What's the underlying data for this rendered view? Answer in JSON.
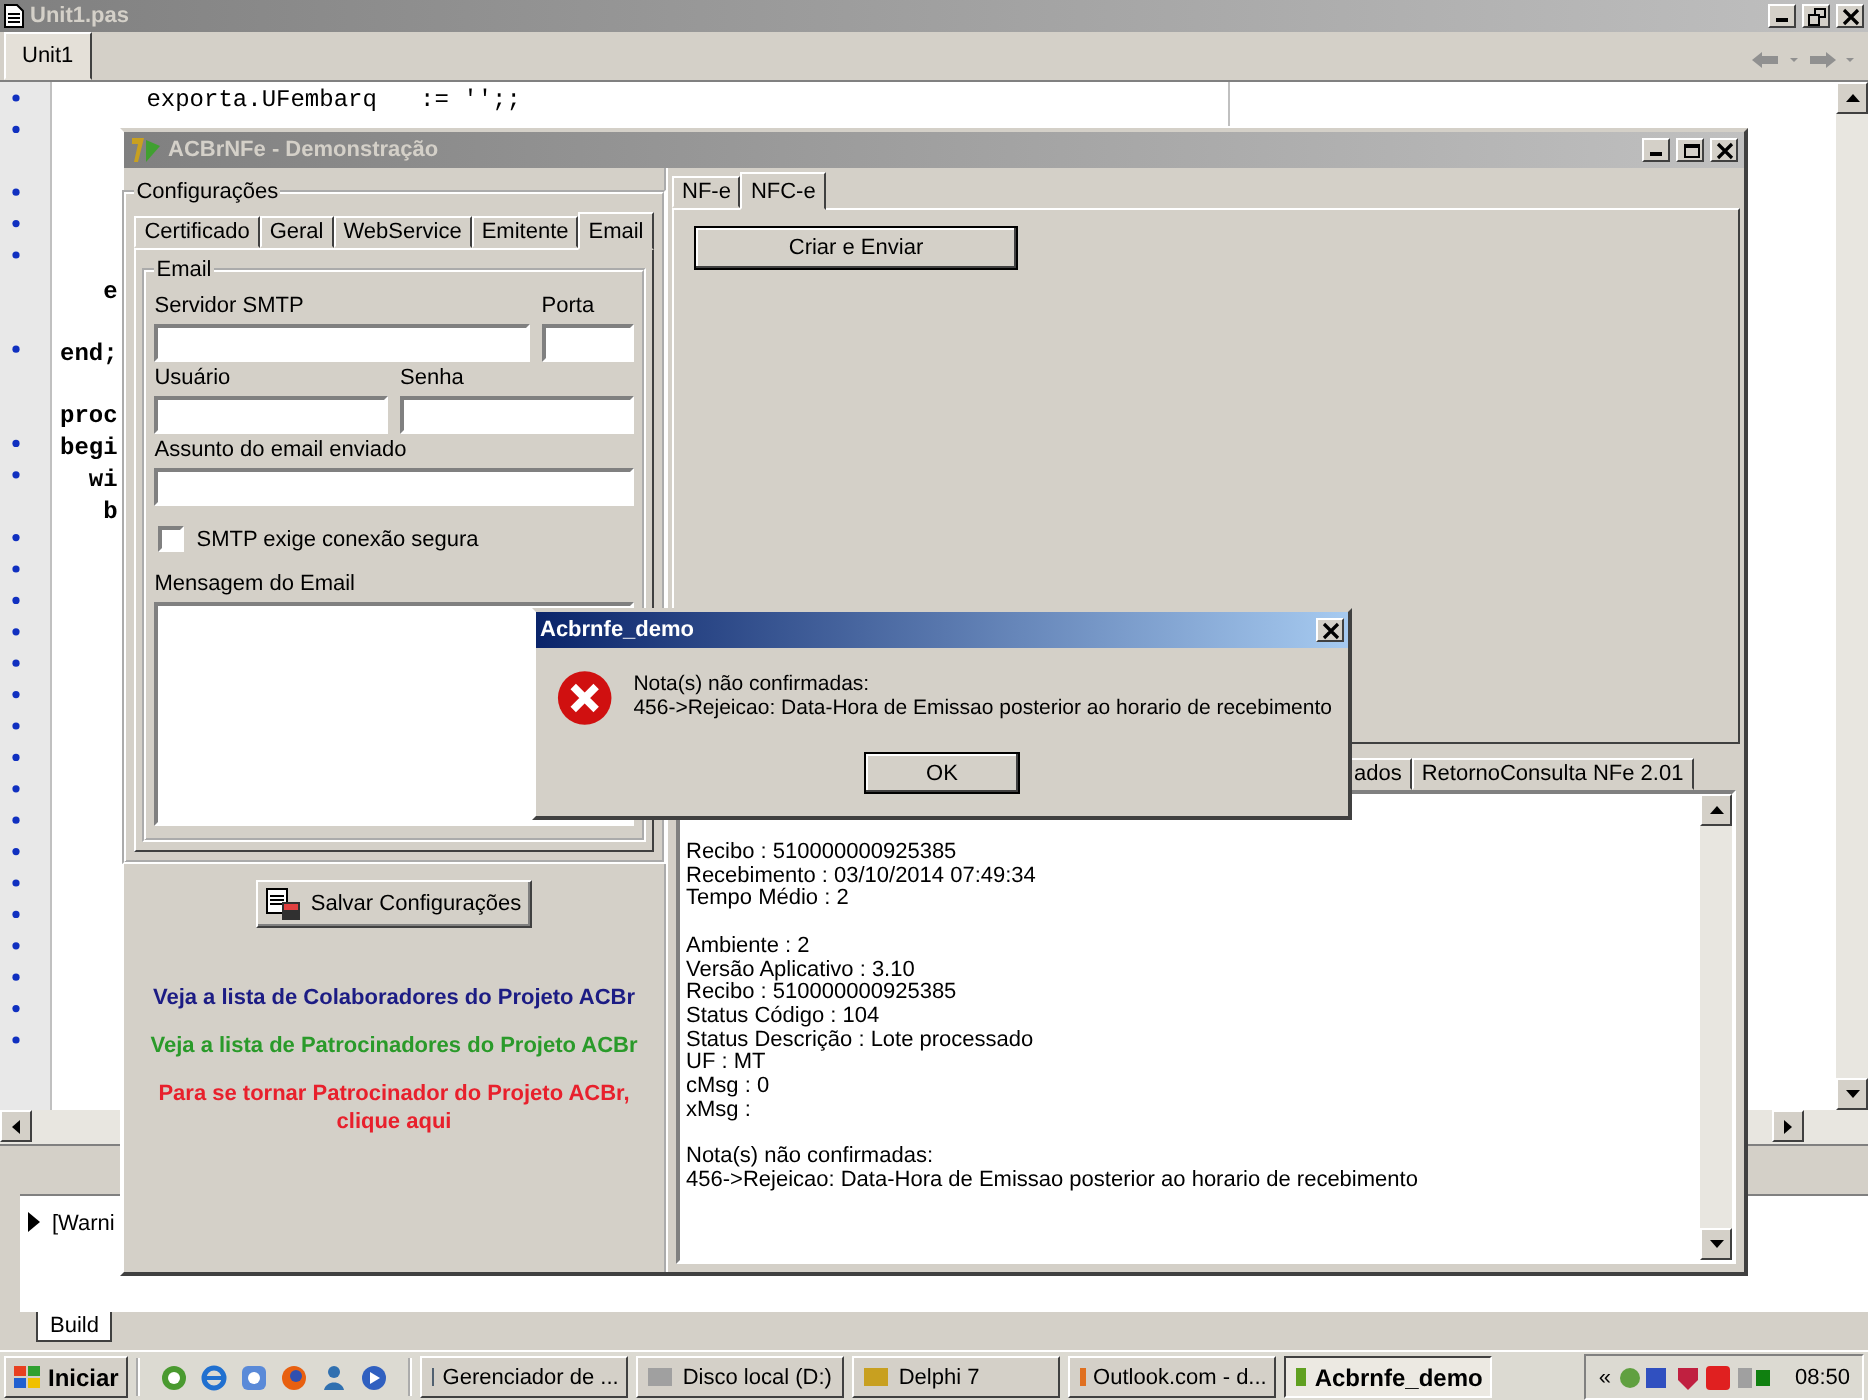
{
  "ide": {
    "title": "Unit1.pas",
    "tabs": [
      {
        "label": "Unit1",
        "selected": true
      }
    ],
    "top_line": {
      "text": "      exporta.UFembarq   := '';;",
      "bold": false
    },
    "lines": [
      {
        "text": "   e",
        "bold": true,
        "space_before": false
      },
      {
        "text": "end;",
        "bold": true,
        "space_before": true
      },
      {
        "text": "proc",
        "bold": true,
        "space_before": true
      },
      {
        "text": "begi",
        "bold": true,
        "space_before": false
      },
      {
        "text": "  wi",
        "bold": true,
        "space_before": false
      },
      {
        "text": "   b",
        "bold": true,
        "space_before": false
      }
    ],
    "messages": [
      "[Warni"
    ],
    "bottom_tabs": [
      {
        "label": "Build",
        "selected": true
      }
    ]
  },
  "app_window": {
    "title": "ACBrNFe - Demonstração",
    "config": {
      "title": "Configurações",
      "tabs": [
        {
          "label": "Certificado",
          "selected": false
        },
        {
          "label": "Geral",
          "selected": false
        },
        {
          "label": "WebService",
          "selected": false
        },
        {
          "label": "Emitente",
          "selected": false
        },
        {
          "label": "Email",
          "selected": true
        }
      ],
      "email": {
        "title": "Email",
        "field_rows": [
          [
            {
              "label": "Servidor SMTP"
            },
            {
              "label": "Porta"
            }
          ],
          [
            {
              "label": "Usuário"
            },
            {
              "label": "Senha"
            }
          ],
          [
            {
              "label": "Assunto do email enviado"
            }
          ]
        ],
        "secure_checkbox": {
          "label": "SMTP exige conexão segura",
          "checked": false
        },
        "message_label": "Mensagem do Email"
      },
      "save_button": "Salvar Configurações"
    },
    "links": [
      {
        "text": "Veja a lista de Colaboradores do Projeto ACBr",
        "color": "#1c1c84"
      },
      {
        "text": "Veja a lista de Patrocinadores do Projeto ACBr",
        "color": "#2a9a2a"
      },
      {
        "text": "Para se tornar Patrocinador do Projeto ACBr, clique aqui",
        "color": "#e8202c"
      }
    ],
    "doc_tabs": [
      {
        "label": "NF-e",
        "selected": false
      },
      {
        "label": "NFC-e",
        "selected": true
      }
    ],
    "send_button": "Criar e Enviar",
    "result_tabs": [
      {
        "label": "ados",
        "selected": false
      },
      {
        "label": "RetornoConsulta NFe 2.01",
        "selected": false
      }
    ],
    "log_blocks": [
      [
        "Recibo : 510000000925385",
        "Recebimento : 03/10/2014 07:49:34",
        "Tempo Médio : 2"
      ],
      [
        "Ambiente : 2",
        "Versão Aplicativo : 3.10",
        "Recibo : 510000000925385",
        "Status Código : 104",
        "Status Descrição : Lote processado",
        "UF : MT",
        "cMsg : 0",
        "xMsg :"
      ],
      [
        "Nota(s) não confirmadas:",
        "456->Rejeicao: Data-Hora de Emissao posterior ao horario de recebimento"
      ]
    ]
  },
  "dialog": {
    "title": "Acbrnfe_demo",
    "message": [
      "Nota(s) não confirmadas:",
      "456->Rejeicao: Data-Hora de Emissao posterior ao horario de recebimento"
    ],
    "button": "OK"
  },
  "taskbar": {
    "start": "Iniciar",
    "tasks": [
      {
        "label": "Gerenciador de ...",
        "selected": false
      },
      {
        "label": "Disco local (D:)",
        "selected": false
      },
      {
        "label": "Delphi 7",
        "selected": false
      },
      {
        "label": "Outlook.com - d...",
        "selected": false
      },
      {
        "label": "Acbrnfe_demo",
        "selected": true
      }
    ],
    "tray_expand": "«",
    "clock": "08:50"
  }
}
